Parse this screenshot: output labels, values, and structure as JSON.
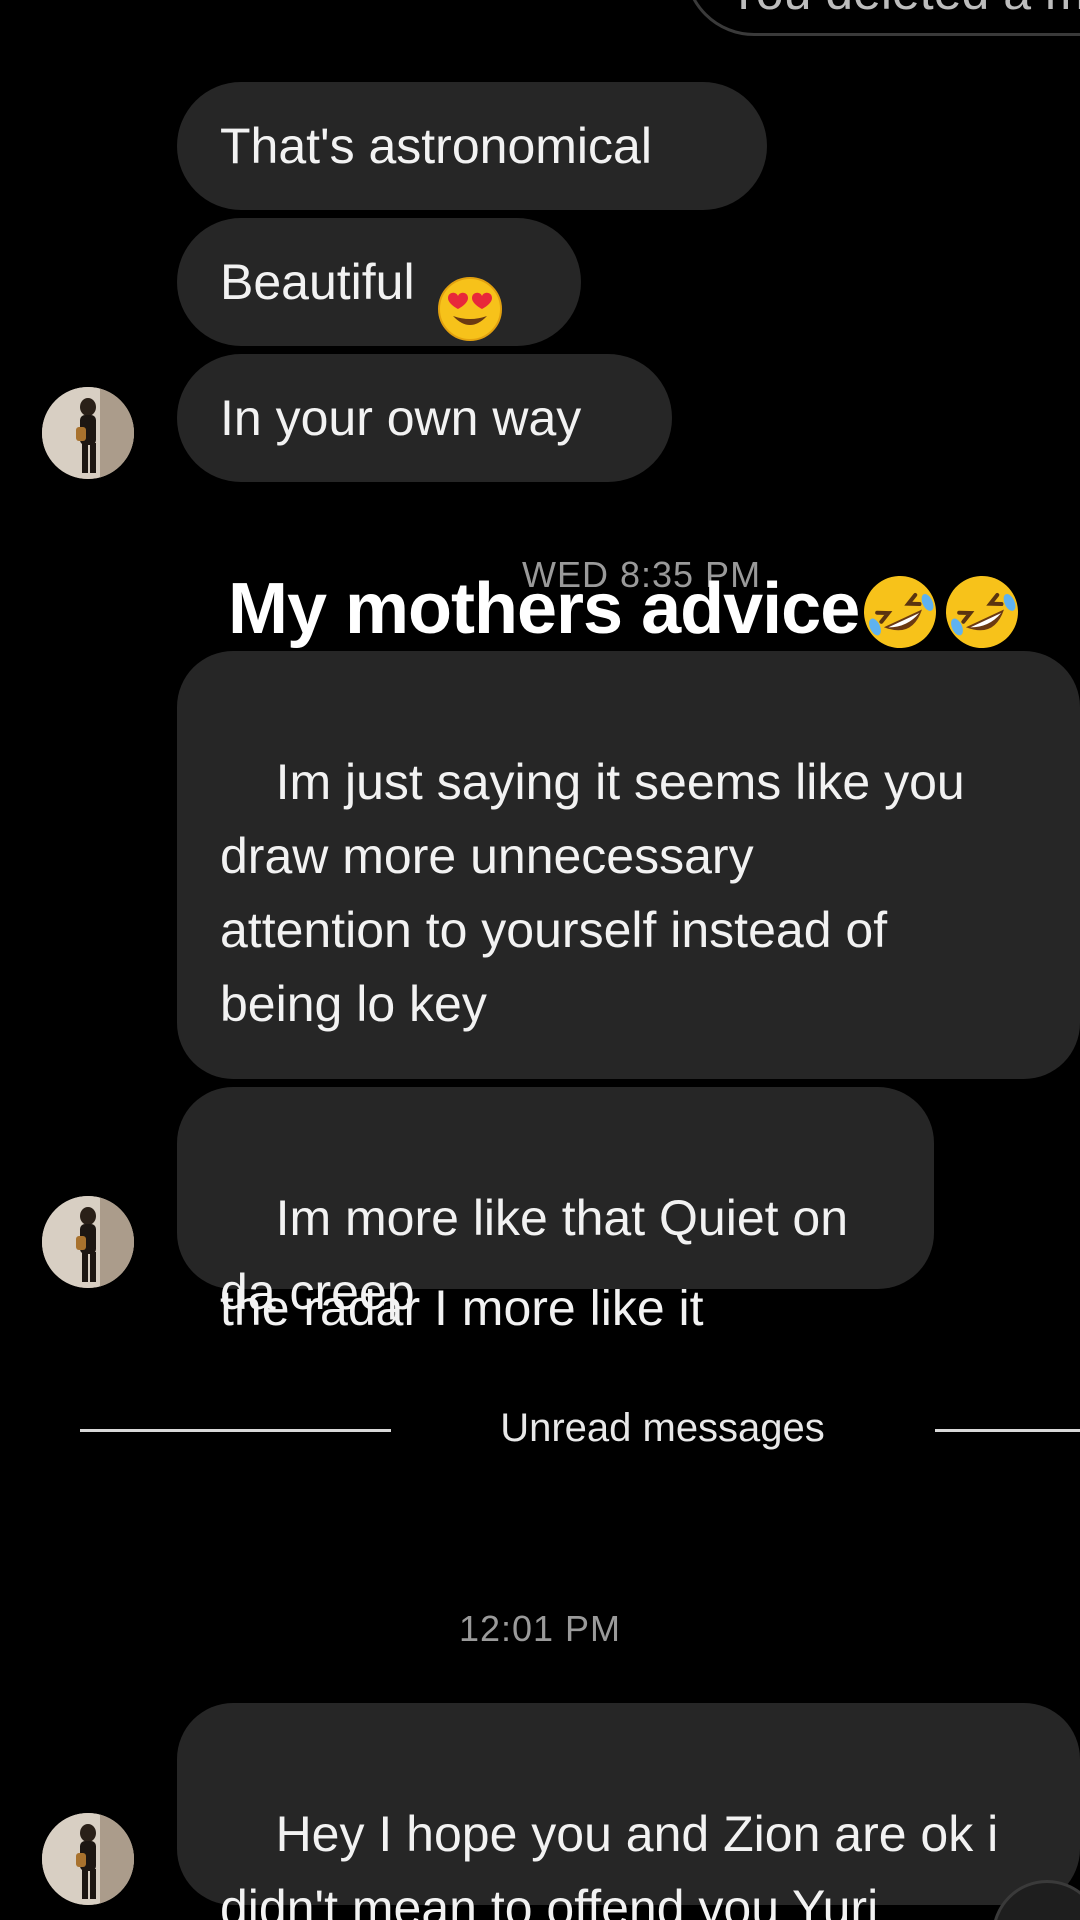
{
  "sent_partial": {
    "text": "You deleted a m"
  },
  "messages": [
    {
      "text": "That's astronomical"
    },
    {
      "text": "Beautiful"
    },
    {
      "text": "In your own way"
    },
    {
      "text": "Im just saying it seems like you\ndraw more unnecessary\nattention to yourself instead of\nbeing lo key"
    },
    {
      "text": "type shit under\nthe radar I more like it"
    },
    {
      "text": "Im more like that Quiet on\nda creep"
    },
    {
      "text": "Hey I hope you and Zion are ok i\ndidn't mean to offend you Yuri"
    }
  ],
  "timestamps": {
    "first": "WED 8:35 PM",
    "second": "12:01 PM"
  },
  "overlay_caption": "My mothers advice",
  "divider": {
    "label": "Unread messages"
  },
  "icons": {
    "heart_eyes": "heart-eyes-emoji",
    "key": "key-emoji",
    "rofl": "rolling-on-floor-laughing-emoji"
  }
}
